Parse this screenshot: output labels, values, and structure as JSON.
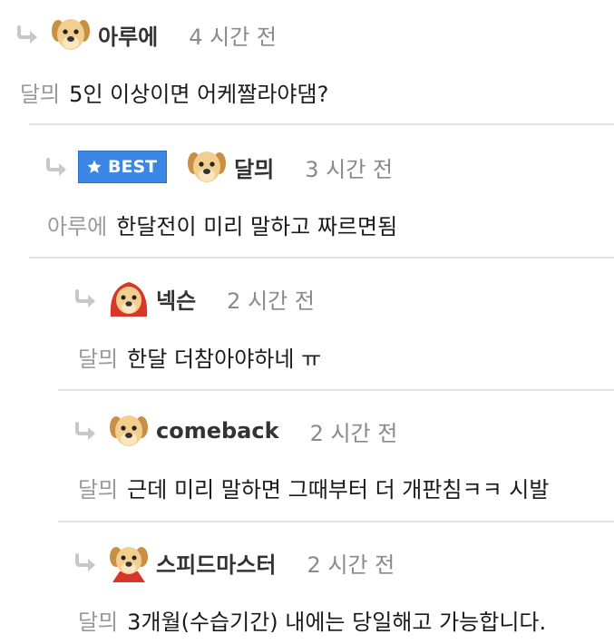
{
  "comments": [
    {
      "author": "아루에",
      "time": "4 시간 전",
      "mention": "달믜",
      "text": "5인 이상이면 어케짤라야댐?"
    },
    {
      "badge": "BEST",
      "author": "달믜",
      "time": "3 시간 전",
      "mention": "아루에",
      "text": "한달전이 미리 말하고 짜르면됨"
    },
    {
      "author": "넥슨",
      "time": "2 시간 전",
      "mention": "달믜",
      "text": "한달 더참아야하네 ㅠ"
    },
    {
      "author": "comeback",
      "time": "2 시간 전",
      "mention": "달믜",
      "text": "근데 미리 말하면 그때부터 더 개판침ㅋㅋ 시발"
    },
    {
      "author": "스피드마스터",
      "time": "2 시간 전",
      "mention": "달믜",
      "text": "3개월(수습기간) 내에는 당일해고 가능합니다."
    }
  ],
  "icons": {
    "reply": "reply-arrow-icon",
    "best": "star-icon",
    "avatar": "puppy-avatar-icon"
  },
  "colors": {
    "best_badge": "#3c87e6",
    "mention": "#9a9a9a",
    "time": "#8a8a8a",
    "divider": "#e2e2e2"
  }
}
